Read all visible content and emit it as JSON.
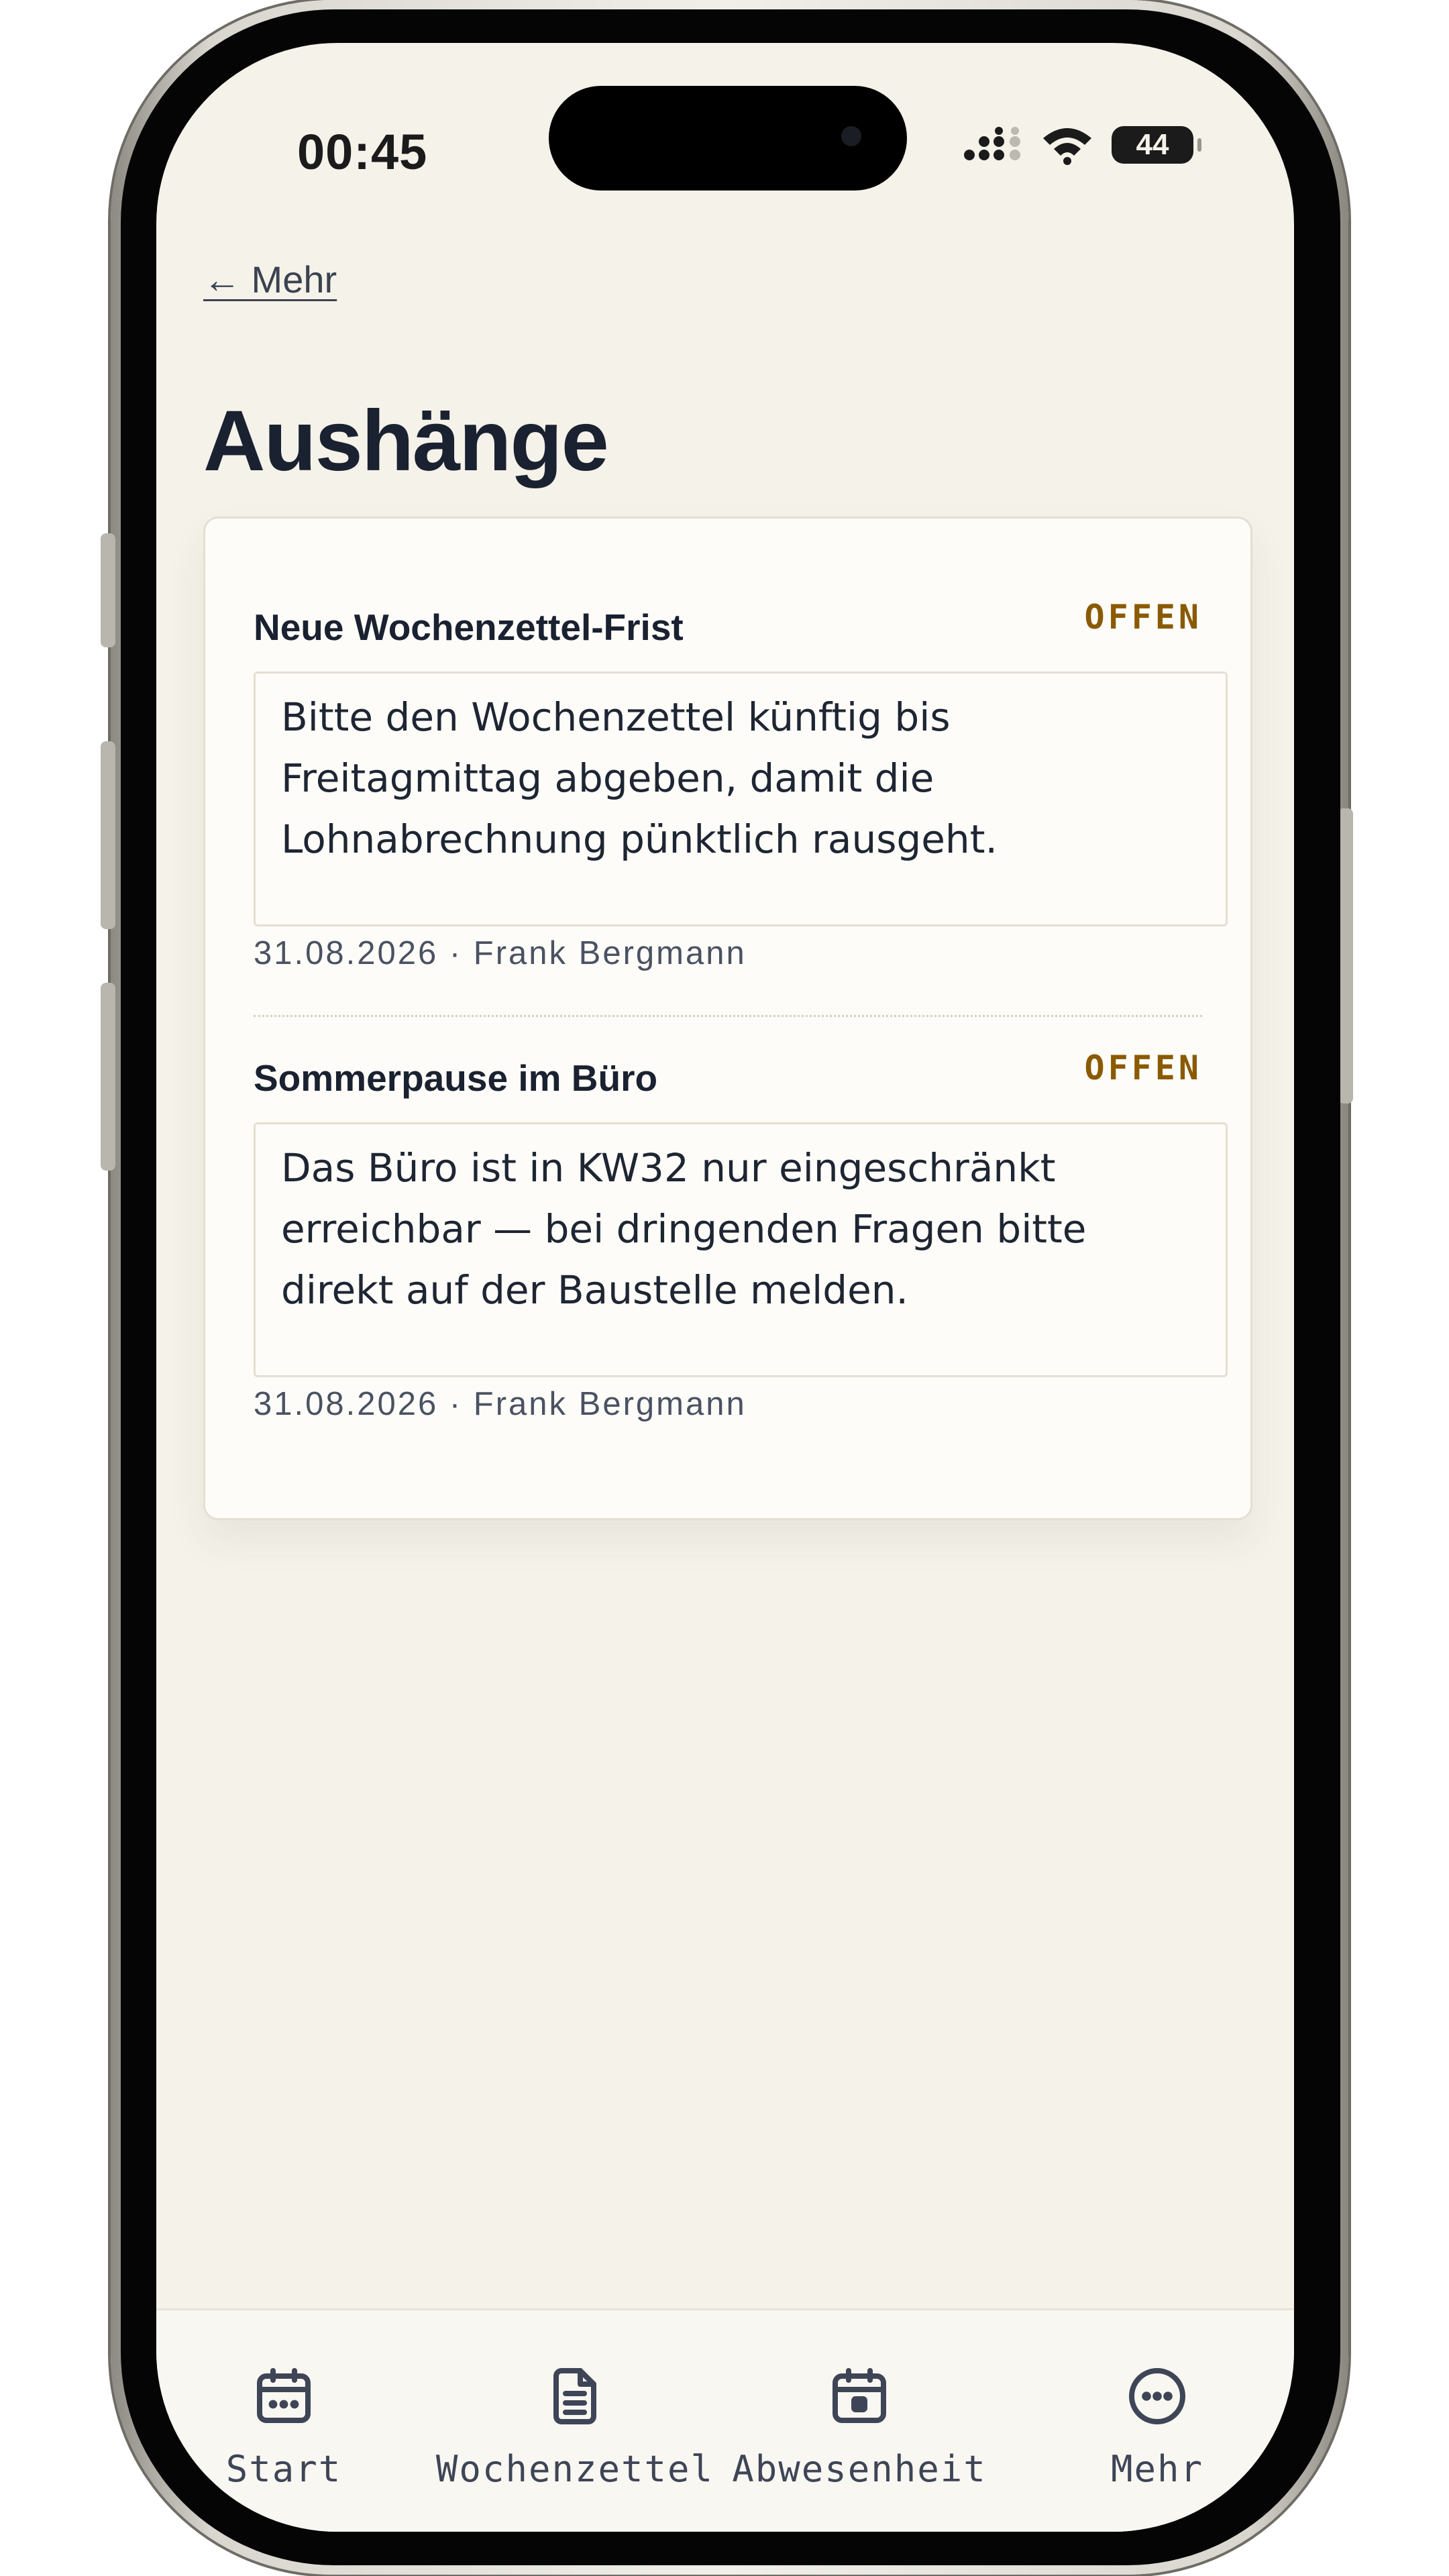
{
  "status_bar": {
    "time": "00:45",
    "battery": "44"
  },
  "nav": {
    "back_label": "← Mehr"
  },
  "page": {
    "title": "Aushänge"
  },
  "notices": [
    {
      "title": "Neue Wochenzettel-Frist",
      "status": "OFFEN",
      "body_lines": [
        "Bitte den Wochenzettel künftig bis",
        "Freitagmittag abgeben, damit die",
        "Lohnabrechnung pünktlich rausgeht."
      ],
      "date": "31.08.2026",
      "author": "Frank Bergmann",
      "meta": "31.08.2026 · Frank Bergmann"
    },
    {
      "title": "Sommerpause im Büro",
      "status": "OFFEN",
      "body_lines": [
        "Das Büro ist in KW32 nur eingeschränkt",
        "erreichbar — bei dringenden Fragen bitte",
        "direkt auf der Baustelle melden."
      ],
      "date": "31.08.2026",
      "author": "Frank Bergmann",
      "meta": "31.08.2026 · Frank Bergmann"
    }
  ],
  "tabbar": {
    "items": [
      {
        "label": "Start",
        "icon": "calendar-grid-icon"
      },
      {
        "label": "Wochenzettel",
        "icon": "document-icon"
      },
      {
        "label": "Abwesenheit",
        "icon": "calendar-day-icon"
      },
      {
        "label": "Mehr",
        "icon": "more-circle-icon"
      }
    ]
  },
  "colors": {
    "background": "#f5f2ea",
    "card": "#fdfcf8",
    "text": "#1a2130",
    "status_open": "#8a5a00",
    "muted": "#4a5262"
  }
}
